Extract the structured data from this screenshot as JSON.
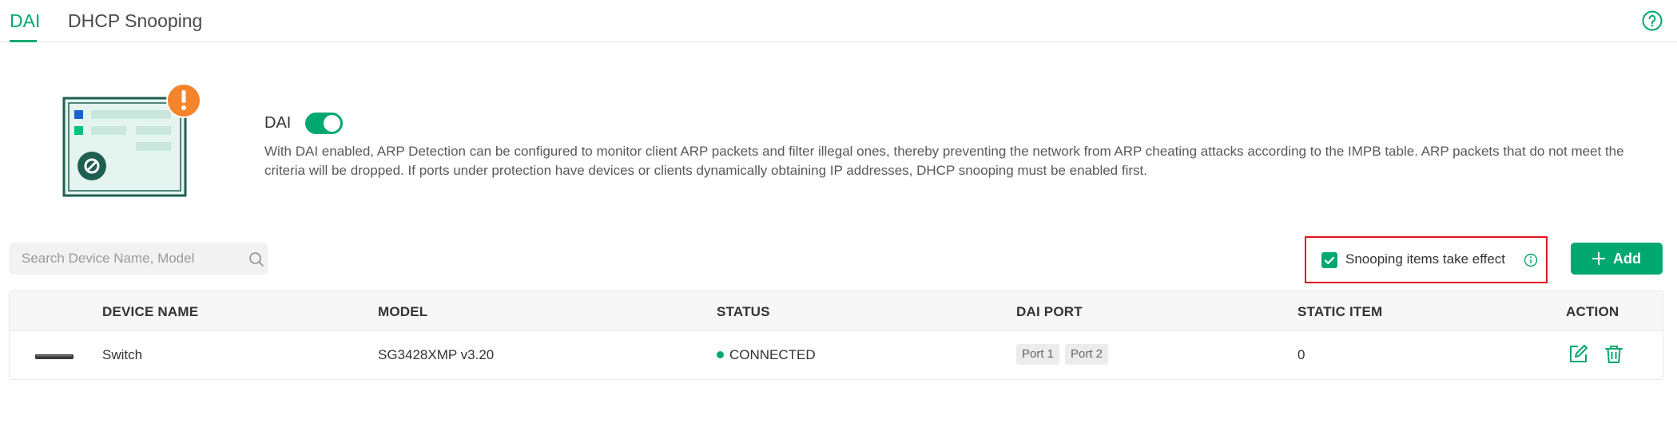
{
  "tabs": [
    {
      "label": "DAI",
      "active": true
    },
    {
      "label": "DHCP Snooping",
      "active": false
    }
  ],
  "help_icon": "question-circle-icon",
  "banner": {
    "label": "DAI",
    "enabled": true,
    "description": "With DAI enabled, ARP Detection can be configured to monitor client ARP packets and filter illegal ones, thereby preventing the network from ARP cheating attacks according to the IMPB table. ARP packets that do not meet the criteria will be dropped. If ports under protection have devices or clients dynamically obtaining IP addresses, DHCP snooping must be enabled first."
  },
  "search": {
    "placeholder": "Search Device Name, Model",
    "value": ""
  },
  "snooping_effect": {
    "label": "Snooping items take effect",
    "checked": true
  },
  "add_button": {
    "label": "Add"
  },
  "table": {
    "columns": [
      "DEVICE NAME",
      "MODEL",
      "STATUS",
      "DAI PORT",
      "STATIC ITEM",
      "ACTION"
    ],
    "rows": [
      {
        "device_name": "Switch",
        "model": "SG3428XMP v3.20",
        "status": "CONNECTED",
        "ports": [
          "Port 1",
          "Port 2"
        ],
        "static_item": "0"
      }
    ]
  },
  "colors": {
    "accent": "#00a870",
    "warning": "#f5842a",
    "highlight_border": "#e0141e"
  }
}
